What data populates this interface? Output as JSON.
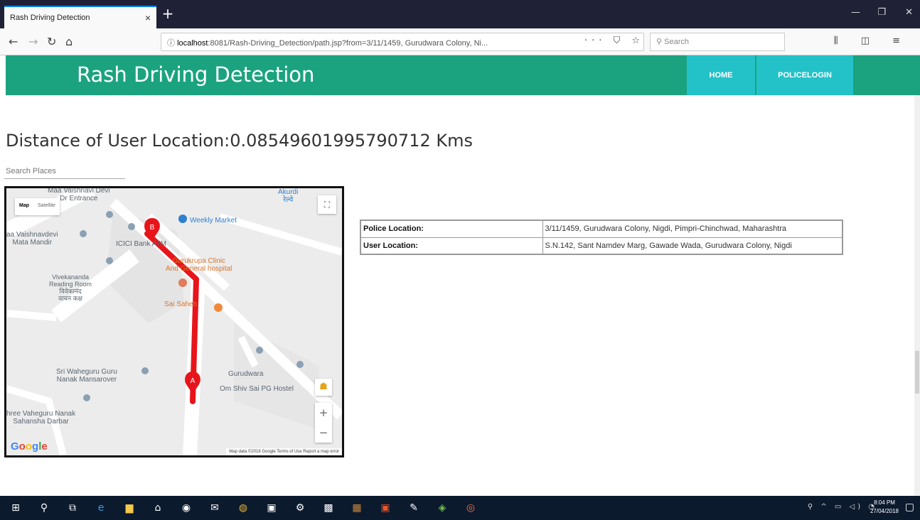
{
  "browser": {
    "tab_title": "Rash Driving Detection",
    "tab_close": "×",
    "new_tab": "+",
    "url_host": "localhost",
    "url_rest": ":8081/Rash-Driving_Detection/path.jsp?from=3/11/1459, Gurudwara Colony, Ni...",
    "url_actions": "··· ⛉ ☆",
    "search_placeholder": "Search",
    "window_minimize": "—",
    "window_restore": "❐",
    "window_close": "✕"
  },
  "site": {
    "title": "Rash Driving Detection",
    "nav": [
      {
        "label": "HOME"
      },
      {
        "label": "POLICELOGIN"
      }
    ]
  },
  "main": {
    "distance_text": "Distance of User Location:0.08549601995790712 Kms",
    "places_search_placeholder": "Search Places"
  },
  "map": {
    "map_type_map": "Map",
    "map_type_satellite": "Satellite",
    "fullscreen": "⛶",
    "zoom_in": "+",
    "zoom_out": "−",
    "logo": "Google",
    "footer": "Map data ©2018 Google   Terms of Use   Report a map error",
    "marker_a": "A",
    "marker_b": "B",
    "route_color": "#e8141b",
    "labels": {
      "vaishnavi_entrance": "Maa Vaishnavi Devi\nDr Entrance",
      "akurdi": "Akurdi\nरेल्वे",
      "weekly_market": "Weekly Market",
      "vaishnadevi_mandir": "aa Vaishnavdevi\nMata Mandir",
      "icici": "ICICI Bank ATM",
      "gurukrupa": "Gurukrupa Clinic\nAnd General hospital",
      "vivekananda": "Vivekananda\nReading Room\n विवेकानंद\n वाचन कक्ष",
      "sai": "Sai Saheb",
      "waheguru": "Sri Waheguru Guru\nNanak Mansarover",
      "gurudwara": "Gurudwara",
      "om_shiv": "Om Shiv Sai PG Hostel",
      "vaheguru_darbar": "hree Vaheguru Nanak\nSahansha Darbar"
    }
  },
  "locations": [
    {
      "label": "Police Location:",
      "value": "3/11/1459, Gurudwara Colony, Nigdi, Pimpri-Chinchwad, Maharashtra"
    },
    {
      "label": "User Location:",
      "value": "S.N.142, Sant Namdev Marg, Gawade Wada, Gurudwara Colony, Nigdi"
    }
  ],
  "taskbar": {
    "clock_time": "8:04 PM",
    "clock_date": "27/04/2018"
  }
}
